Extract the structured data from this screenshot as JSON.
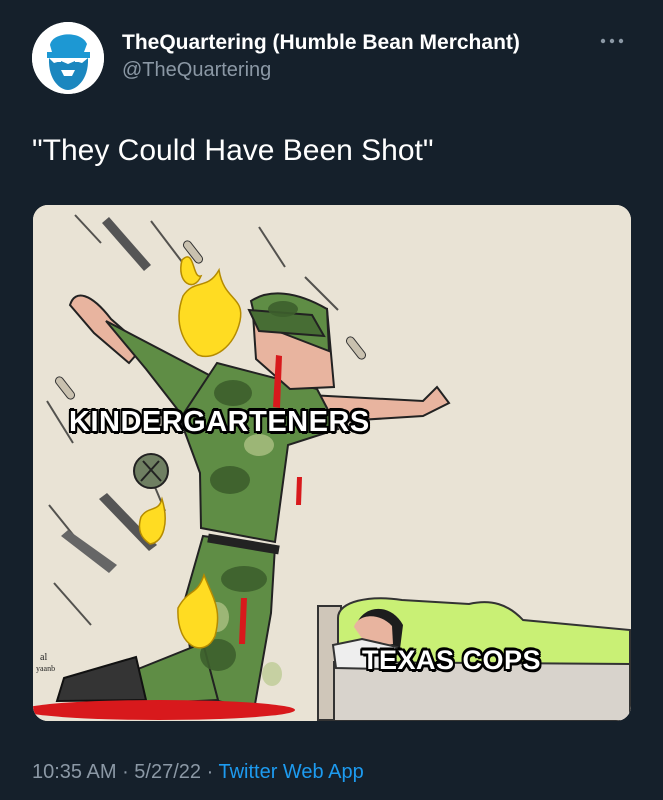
{
  "tweet": {
    "display_name": "TheQuartering (Humble Bean Merchant)",
    "handle": "@TheQuartering",
    "text": "\"They Could Have Been Shot\"",
    "more_icon": "more-horizontal-icon",
    "avatar_icon": "bearded-man-avatar",
    "time": "10:35 AM",
    "separator_1": " · ",
    "date": "5/27/22",
    "separator_2": " · ",
    "source": "Twitter Web App"
  },
  "image": {
    "caption_top": "KINDERGARTENERS",
    "caption_bottom": "TEXAS COPS",
    "signature": "al\nyaanb"
  },
  "colors": {
    "background": "#15202b",
    "primary_text": "#ffffff",
    "secondary_text": "#8b98a5",
    "link": "#1d9bf0",
    "meme_background": "#e7e0d3",
    "camo_green": "#5d8a45",
    "flames": "#ffdc22",
    "blood": "#d8191c"
  }
}
